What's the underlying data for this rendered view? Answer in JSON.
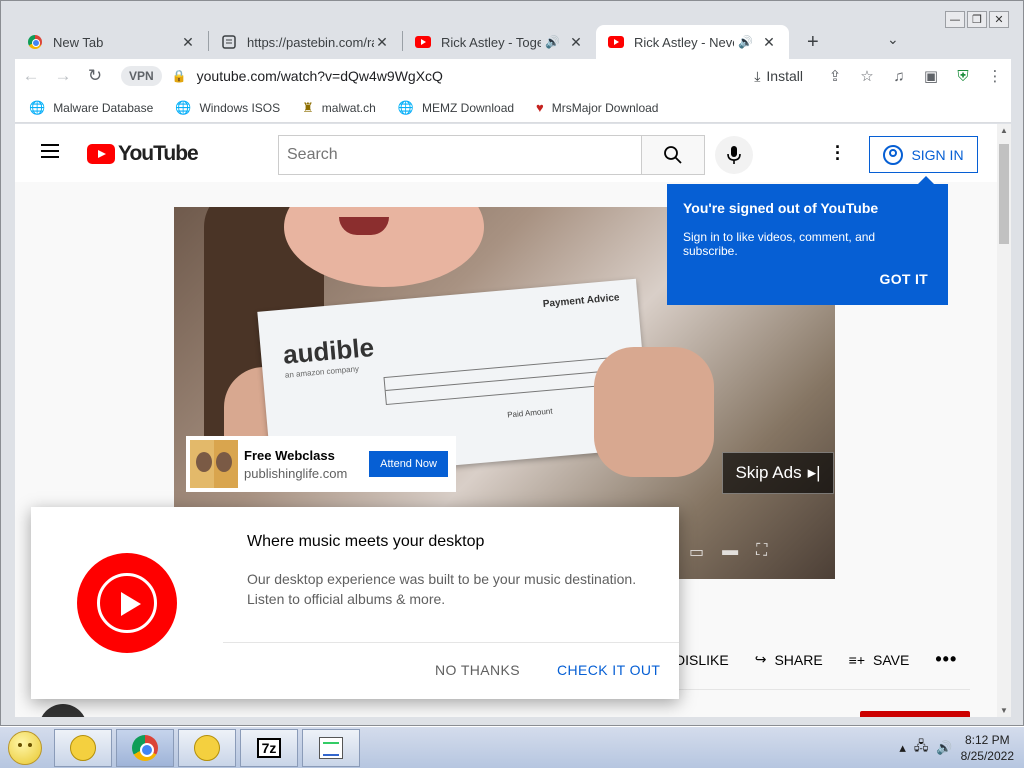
{
  "window_controls": {
    "minimize": "—",
    "restore": "❐",
    "close": "✕"
  },
  "tabs": [
    {
      "title": "New Tab",
      "icon": "chrome-icon",
      "audio": false
    },
    {
      "title": "https://pastebin.com/raw",
      "icon": "pastebin-icon",
      "audio": false
    },
    {
      "title": "Rick Astley - Together Forever",
      "icon": "youtube-icon",
      "audio": true
    },
    {
      "title": "Rick Astley - Never Gonna Give You Up",
      "icon": "youtube-icon",
      "audio": true
    }
  ],
  "toolbar": {
    "vpn": "VPN",
    "url": "youtube.com/watch?v=dQw4w9WgXcQ",
    "install": "Install"
  },
  "bookmarks": [
    {
      "label": "Malware Database",
      "icon": "globe-icon"
    },
    {
      "label": "Windows ISOS",
      "icon": "globe-icon"
    },
    {
      "label": "malwat.ch",
      "icon": "bug-icon"
    },
    {
      "label": "MEMZ Download",
      "icon": "globe-icon"
    },
    {
      "label": "MrsMajor Download",
      "icon": "heart-icon"
    }
  ],
  "youtube": {
    "logo_text": "YouTube",
    "search_placeholder": "Search",
    "sign_in": "SIGN IN"
  },
  "tooltip": {
    "title": "You're signed out of YouTube",
    "body": "Sign in to like videos, comment, and subscribe.",
    "button": "GOT IT"
  },
  "ad": {
    "title": "Free Webclass",
    "domain": "publishinglife.com",
    "button": "Attend Now",
    "skip": "Skip Ads"
  },
  "video_paper": {
    "brand": "audible",
    "sub": "an amazon company",
    "heading": "Payment Advice",
    "paid": "Paid Amount"
  },
  "actions": {
    "dislike": "DISLIKE",
    "share": "SHARE",
    "save": "SAVE",
    "more": "•••"
  },
  "music_popup": {
    "title": "Where music meets your desktop",
    "body": "Our desktop experience was built to be your music destination. Listen to official albums & more.",
    "no_thanks": "NO THANKS",
    "check_it_out": "CHECK IT OUT"
  },
  "taskbar": {
    "time": "8:12 PM",
    "date": "8/25/2022"
  }
}
